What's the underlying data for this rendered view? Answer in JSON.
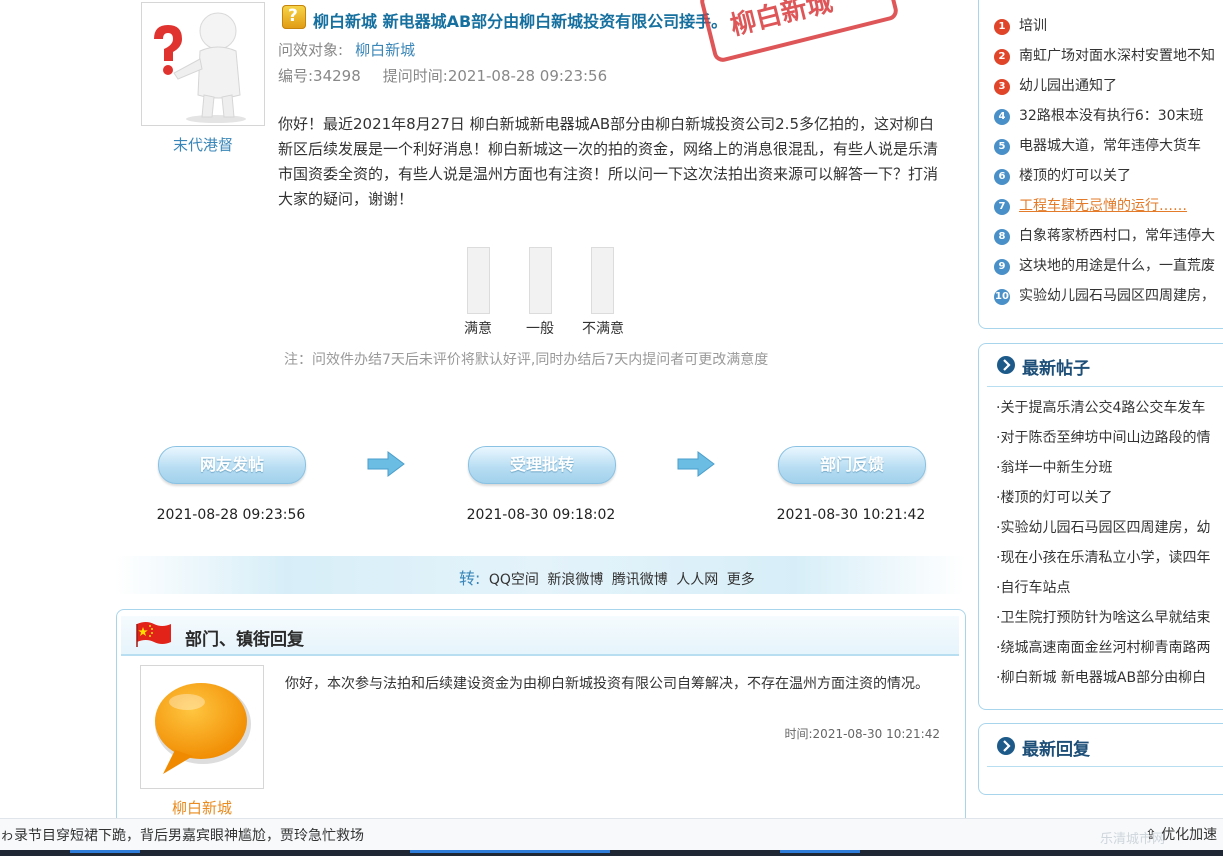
{
  "question": {
    "asker_name": "末代港督",
    "title": "柳白新城 新电器城AB部分由柳白新城投资有限公司接手。",
    "stamp_text": "柳白新城",
    "target_label": "问效对象:",
    "target_value": "柳白新城",
    "id_label": "编号:34298",
    "time_label": "提问时间:2021-08-28 09:23:56",
    "body": "你好！最近2021年8月27日 柳白新城新电器城AB部分由柳白新城投资公司2.5多亿拍的，这对柳白新区后续发展是一个利好消息！柳白新城这一次的拍的资金，网络上的消息很混乱，有些人说是乐清市国资委全资的，有些人说是温州方面也有注资！所以问一下这次法拍出资来源可以解答一下？打消大家的疑问，谢谢！"
  },
  "satisfaction": {
    "options": [
      {
        "label": "满意",
        "level": 0
      },
      {
        "label": "一般",
        "level": 0
      },
      {
        "label": "不满意",
        "level": 0
      }
    ],
    "note": "注：问效件办结7天后未评价将默认好评,同时办结后7天内提问者可更改满意度"
  },
  "process": {
    "steps": [
      {
        "label": "网友发帖",
        "time": "2021-08-28 09:23:56"
      },
      {
        "label": "受理批转",
        "time": "2021-08-30 09:18:02"
      },
      {
        "label": "部门反馈",
        "time": "2021-08-30 10:21:42"
      }
    ]
  },
  "share": {
    "prefix": "转:",
    "items": [
      "QQ空间",
      "新浪微博",
      "腾讯微博",
      "人人网",
      "更多"
    ]
  },
  "reply": {
    "header": "部门、镇街回复",
    "dept_name": "柳白新城",
    "body": "你好，本次参与法拍和后续建设资金为由柳白新城投资有限公司自筹解决，不存在温州方面注资的情况。",
    "time": "时间:2021-08-30 10:21:42"
  },
  "sidebar": {
    "hot_items": [
      {
        "num": "1",
        "text": "培训",
        "color": "red"
      },
      {
        "num": "2",
        "text": "南虹广场对面水深村安置地不知",
        "color": "red"
      },
      {
        "num": "3",
        "text": "幼儿园出通知了",
        "color": "red"
      },
      {
        "num": "4",
        "text": "32路根本没有执行6：30末班",
        "color": "blue"
      },
      {
        "num": "5",
        "text": "电器城大道，常年违停大货车",
        "color": "blue"
      },
      {
        "num": "6",
        "text": "楼顶的灯可以关了",
        "color": "blue"
      },
      {
        "num": "7",
        "text": "工程车肆无忌惮的运行……",
        "color": "blue",
        "active": true
      },
      {
        "num": "8",
        "text": "白象蒋家桥西村口，常年违停大",
        "color": "blue"
      },
      {
        "num": "9",
        "text": "这块地的用途是什么，一直荒废",
        "color": "blue"
      },
      {
        "num": "10",
        "text": "实验幼儿园石马园区四周建房，",
        "color": "blue"
      }
    ],
    "latest_posts_title": "最新帖子",
    "latest_posts": [
      "关于提高乐清公交4路公交车发车",
      "对于陈岙至绅坊中间山边路段的情",
      "翁垟一中新生分班",
      "楼顶的灯可以关了",
      "实验幼儿园石马园区四周建房，幼",
      "现在小孩在乐清私立小学，读四年",
      "自行车站点",
      "卫生院打预防针为啥这么早就结束",
      "绕城高速南面金丝河村柳青南路两",
      "柳白新城 新电器城AB部分由柳白"
    ],
    "latest_replies_title": "最新回复"
  },
  "status_bar": {
    "news": "ゎ录节目穿短裙下跪，背后男嘉宾眼神尴尬，贾玲急忙救场",
    "watermark": "乐清城市网",
    "accel_label": "优化加速"
  },
  "colors": {
    "link_blue": "#16709f",
    "accent_orange": "#e98b1f",
    "stamp_red": "#d9393b",
    "panel_border": "#a9d5ec"
  }
}
